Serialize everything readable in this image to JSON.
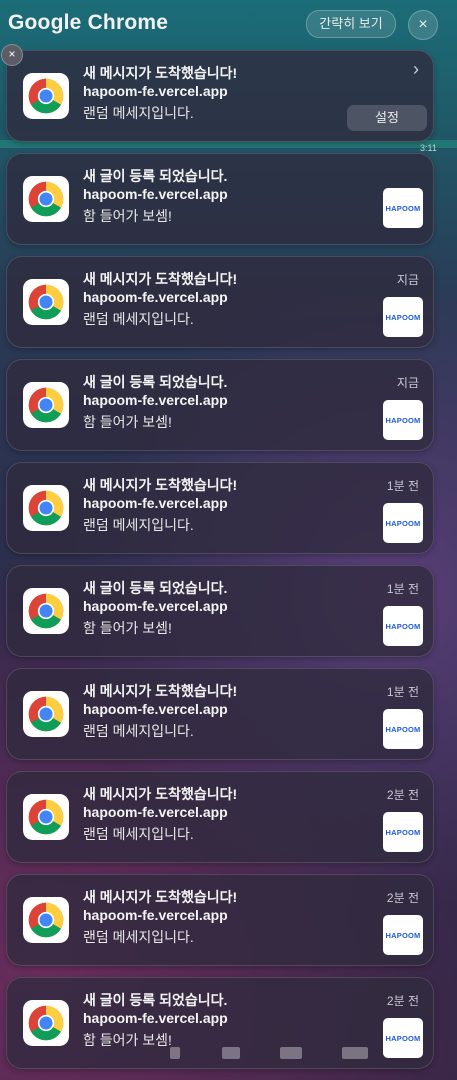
{
  "header": {
    "app_title": "Google Chrome",
    "collapse_label": "간략히 보기",
    "close_all_icon": "×"
  },
  "background": {
    "time": "3:11"
  },
  "first_card": {
    "settings_label": "설정",
    "chevron": "›",
    "close_icon": "×"
  },
  "thumbnail_text": "HAPOOM",
  "notifications": [
    {
      "title": "새 메시지가 도착했습니다!",
      "site": "hapoom-fe.vercel.app",
      "body": "랜덤 메세지입니다.",
      "time": ""
    },
    {
      "title": "새 글이 등록 되었습니다.",
      "site": "hapoom-fe.vercel.app",
      "body": "함 들어가 보셈!",
      "time": ""
    },
    {
      "title": "새 메시지가 도착했습니다!",
      "site": "hapoom-fe.vercel.app",
      "body": "랜덤 메세지입니다.",
      "time": "지금"
    },
    {
      "title": "새 글이 등록 되었습니다.",
      "site": "hapoom-fe.vercel.app",
      "body": "함 들어가 보셈!",
      "time": "지금"
    },
    {
      "title": "새 메시지가 도착했습니다!",
      "site": "hapoom-fe.vercel.app",
      "body": "랜덤 메세지입니다.",
      "time": "1분 전"
    },
    {
      "title": "새 글이 등록 되었습니다.",
      "site": "hapoom-fe.vercel.app",
      "body": "함 들어가 보셈!",
      "time": "1분 전"
    },
    {
      "title": "새 메시지가 도착했습니다!",
      "site": "hapoom-fe.vercel.app",
      "body": "랜덤 메세지입니다.",
      "time": "1분 전"
    },
    {
      "title": "새 메시지가 도착했습니다!",
      "site": "hapoom-fe.vercel.app",
      "body": "랜덤 메세지입니다.",
      "time": "2분 전"
    },
    {
      "title": "새 메시지가 도착했습니다!",
      "site": "hapoom-fe.vercel.app",
      "body": "랜덤 메세지입니다.",
      "time": "2분 전"
    },
    {
      "title": "새 글이 등록 되었습니다.",
      "site": "hapoom-fe.vercel.app",
      "body": "함 들어가 보셈!",
      "time": "2분 전"
    }
  ]
}
